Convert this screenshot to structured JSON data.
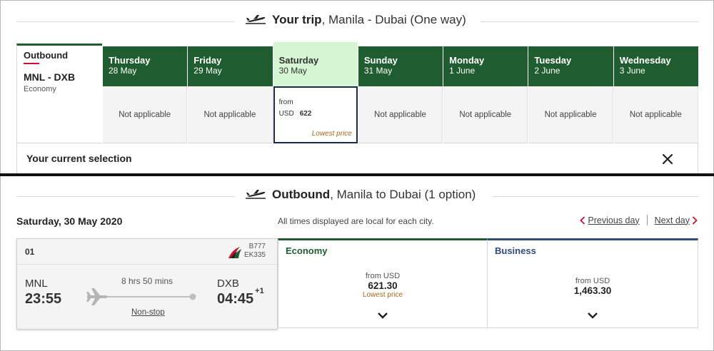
{
  "trip_header": {
    "title_bold": "Your trip",
    "title_rest": ", Manila - Dubai (One way)"
  },
  "outbound_card": {
    "label": "Outbound",
    "route": "MNL - DXB",
    "cabin": "Economy"
  },
  "days": [
    {
      "name": "Thursday",
      "date": "28 May",
      "status": "Not applicable"
    },
    {
      "name": "Friday",
      "date": "29 May",
      "status": "Not applicable"
    },
    {
      "name": "Saturday",
      "date": "30 May",
      "from": "from",
      "currency": "USD",
      "price": "622",
      "note": "Lowest price",
      "selected": true
    },
    {
      "name": "Sunday",
      "date": "31 May",
      "status": "Not applicable"
    },
    {
      "name": "Monday",
      "date": "1 June",
      "status": "Not applicable"
    },
    {
      "name": "Tuesday",
      "date": "2 June",
      "status": "Not applicable"
    },
    {
      "name": "Wednesday",
      "date": "3 June",
      "status": "Not applicable"
    }
  ],
  "current_selection": {
    "title": "Your current selection"
  },
  "outbound_header": {
    "title_bold": "Outbound",
    "title_rest": ", Manila to Dubai (1 option)"
  },
  "date_title": "Saturday, 30 May 2020",
  "times_note": "All times displayed are local for each city.",
  "nav": {
    "previous": "Previous day",
    "next": "Next day"
  },
  "flight": {
    "number": "01",
    "aircraft": "B777",
    "flight_code": "EK335",
    "origin": "MNL",
    "departure": "23:55",
    "duration": "8 hrs 50 mins",
    "stops": "Non-stop",
    "destination": "DXB",
    "arrival": "04:45",
    "day_offset": "+1"
  },
  "fares": {
    "economy": {
      "title": "Economy",
      "from": "from USD",
      "price": "621.30",
      "note": "Lowest price"
    },
    "business": {
      "title": "Business",
      "from": "from USD",
      "price": "1,463.30"
    }
  },
  "colors": {
    "emirates_green": "#1f5c2f",
    "selected_day": "#d6f5d2",
    "business_blue": "#2f4b7c",
    "lowest_price": "#a5691f",
    "accent_red": "#c8102e"
  }
}
